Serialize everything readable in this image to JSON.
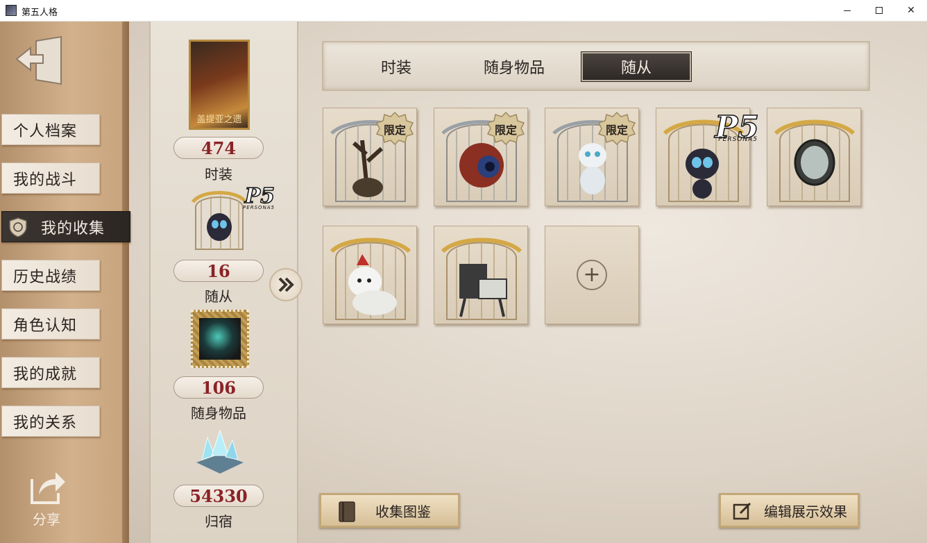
{
  "window": {
    "title": "第五人格",
    "controls": [
      "minimize",
      "maximize",
      "close"
    ]
  },
  "sidebar": {
    "back_icon": "exit-door-icon",
    "items": [
      {
        "label": "个人档案"
      },
      {
        "label": "我的战斗"
      },
      {
        "label": "我的收集",
        "active": true
      },
      {
        "label": "历史战绩"
      },
      {
        "label": "角色认知"
      },
      {
        "label": "我的成就"
      },
      {
        "label": "我的关系"
      }
    ],
    "share_label": "分享"
  },
  "stats": [
    {
      "card_caption": "盖提亚之遗",
      "value": "474",
      "label": "时装"
    },
    {
      "value": "16",
      "label": "随从"
    },
    {
      "value": "106",
      "label": "随身物品"
    },
    {
      "value": "54330",
      "label": "归宿"
    }
  ],
  "tabs": [
    {
      "label": "时装"
    },
    {
      "label": "随身物品"
    },
    {
      "label": "随从",
      "active": true
    }
  ],
  "companions": [
    {
      "badge": "限定",
      "icon": "tree-creature-icon"
    },
    {
      "badge": "限定",
      "icon": "eyeball-icon"
    },
    {
      "badge": "限定",
      "icon": "white-cat-icon"
    },
    {
      "logo": "P5",
      "logo_sub": "PERSONA5",
      "icon": "morgana-cat-icon"
    },
    {
      "icon": "mirror-icon"
    },
    {
      "icon": "white-fox-icon"
    },
    {
      "icon": "mech-chair-icon"
    },
    {
      "empty": true,
      "icon": "add-icon"
    }
  ],
  "stat_logo": {
    "logo": "P5",
    "logo_sub": "PERSONA5"
  },
  "buttons": {
    "collection_guide": "收集图鉴",
    "edit_display": "编辑展示效果"
  }
}
